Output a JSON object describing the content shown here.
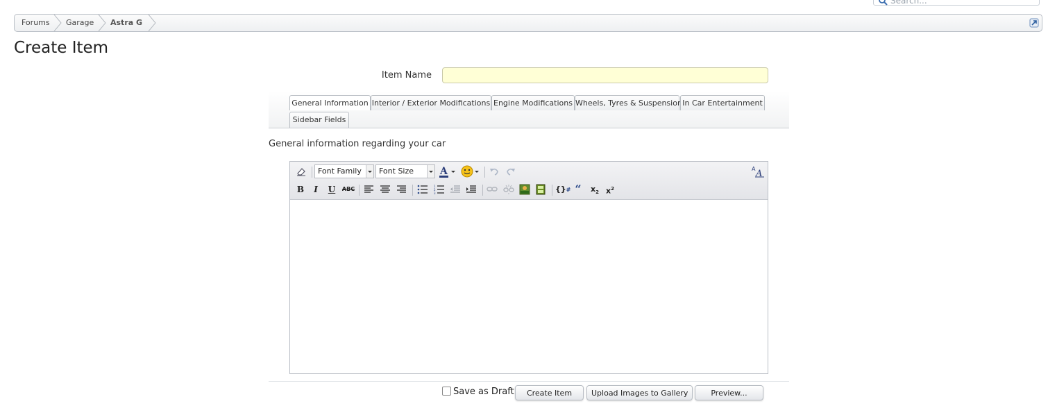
{
  "search": {
    "placeholder": "Search..."
  },
  "breadcrumb": {
    "items": [
      "Forums",
      "Garage",
      "Astra G"
    ]
  },
  "page": {
    "title": "Create Item"
  },
  "form": {
    "item_name_label": "Item Name",
    "item_name_value": ""
  },
  "tabs": [
    {
      "label": "General Information",
      "active": true
    },
    {
      "label": "Interior / Exterior Modifications"
    },
    {
      "label": "Engine Modifications"
    },
    {
      "label": "Wheels, Tyres & Suspension"
    },
    {
      "label": "In Car Entertainment"
    },
    {
      "label": "Sidebar Fields"
    }
  ],
  "tab_description": "General information regarding your car",
  "editor": {
    "font_family": "Font Family",
    "font_size": "Font Size",
    "content": ""
  },
  "footer": {
    "save_draft_label": "Save as Draft",
    "save_draft_checked": false,
    "create_label": "Create Item",
    "upload_label": "Upload Images to Gallery",
    "preview_label": "Preview..."
  },
  "colors": {
    "input_bg": "#ffffd6",
    "accent": "#2b5d9e"
  }
}
